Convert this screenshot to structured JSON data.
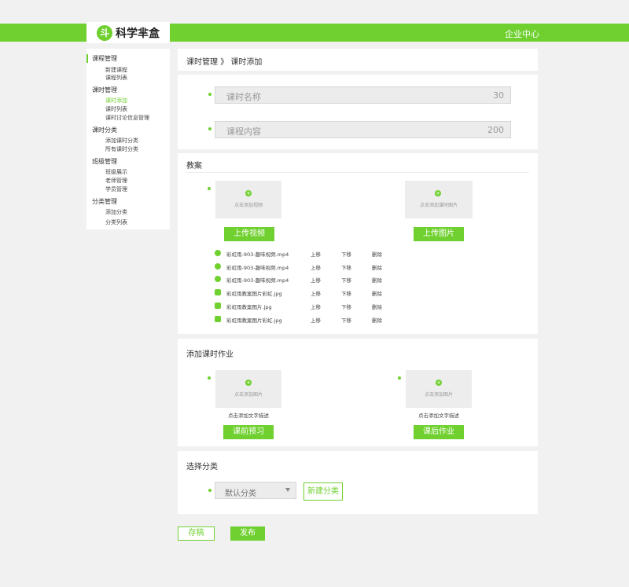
{
  "brand": {
    "logo_glyph": "斗",
    "name": "科学芈盒"
  },
  "header": {
    "enterprise_center": "企业中心"
  },
  "sidebar": {
    "groups": [
      {
        "label": "课程管理",
        "items": [
          "新建课程",
          "课程列表"
        ]
      },
      {
        "label": "课时管理",
        "items": [
          "课时添加",
          "课时列表",
          "课时讨论信息管理"
        ]
      },
      {
        "label": "课时分类",
        "items": [
          "添加课时分类",
          "所有课时分类"
        ]
      },
      {
        "label": "班级管理",
        "items": [
          "班级展示",
          "老师管理",
          "学员管理"
        ]
      },
      {
        "label": "分类管理",
        "items": [
          "添加分类",
          "分类列表"
        ]
      }
    ],
    "active_item": "课时添加"
  },
  "breadcrumb": {
    "parent": "课时管理",
    "sep": "》",
    "current": "课时添加"
  },
  "form": {
    "title_placeholder": "课时名称",
    "title_limit": "30",
    "content_placeholder": "课程内容",
    "content_limit": "200"
  },
  "lesson_plan": {
    "title": "教案",
    "video_box_text": "点击添加视频",
    "image_box_text": "点击添加课时图片",
    "upload_video": "上传视频",
    "upload_image": "上传图片",
    "files": [
      {
        "name": "彩虹雨-903-趣味视频.mp4",
        "type": "video",
        "up": "上移",
        "down": "下移",
        "del": "删除"
      },
      {
        "name": "彩虹雨-903-趣味视频.mp4",
        "type": "video",
        "up": "上移",
        "down": "下移",
        "del": "删除"
      },
      {
        "name": "彩虹雨-903-趣味视频.mp4",
        "type": "video",
        "up": "上移",
        "down": "下移",
        "del": "删除"
      },
      {
        "name": "彩虹雨教案图片彩虹.jpg",
        "type": "image",
        "up": "上移",
        "down": "下移",
        "del": "删除"
      },
      {
        "name": "彩虹雨教案图片.jpg",
        "type": "image",
        "up": "上移",
        "down": "下移",
        "del": "删除"
      },
      {
        "name": "彩虹雨教案图片彩虹.jpg",
        "type": "image",
        "up": "上移",
        "down": "下移",
        "del": "删除"
      }
    ]
  },
  "homework": {
    "title": "添加课时作业",
    "box_text": "点击添加图片",
    "desc_text": "点击添加文字描述",
    "pre_button": "课前预习",
    "post_button": "课后作业"
  },
  "category": {
    "title": "选择分类",
    "selected": "默认分类",
    "new_button": "新建分类"
  },
  "actions": {
    "save": "存稿",
    "publish": "发布"
  },
  "colors": {
    "accent": "#6fd02f",
    "background": "#f1f1f1"
  }
}
